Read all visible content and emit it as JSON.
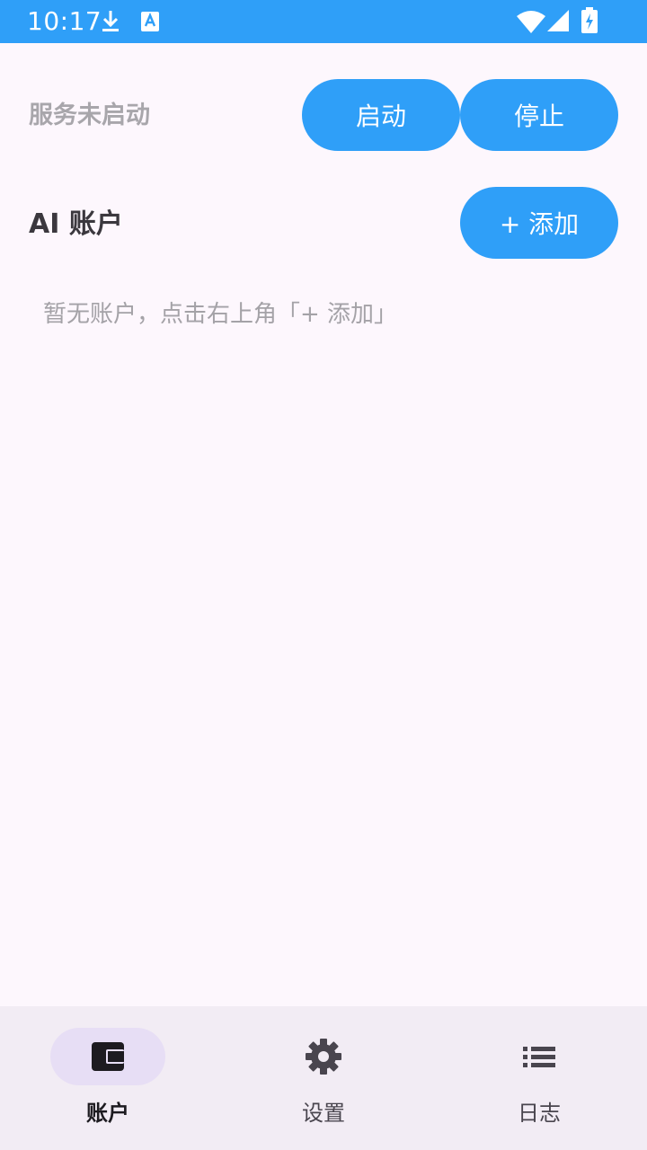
{
  "status_bar": {
    "time": "10:17",
    "background": "#2f9ff8",
    "icons": [
      "download-icon",
      "text-a-icon",
      "wifi-icon",
      "cell-signal-icon",
      "battery-charging-icon"
    ]
  },
  "service": {
    "status_text": "服务未启动",
    "start_label": "启动",
    "stop_label": "停止"
  },
  "accounts": {
    "title": "AI 账户",
    "add_label": "+ 添加",
    "empty_hint": "暂无账户，点击右上角「+ 添加」"
  },
  "bottom_nav": {
    "items": [
      {
        "label": "账户",
        "icon": "wallet-icon",
        "active": true
      },
      {
        "label": "设置",
        "icon": "gear-icon",
        "active": false
      },
      {
        "label": "日志",
        "icon": "list-icon",
        "active": false
      }
    ]
  },
  "colors": {
    "accent": "#2f9ff8",
    "background": "#fdf7fd",
    "nav_background": "#f2ecf4",
    "nav_indicator": "#e7def5"
  }
}
